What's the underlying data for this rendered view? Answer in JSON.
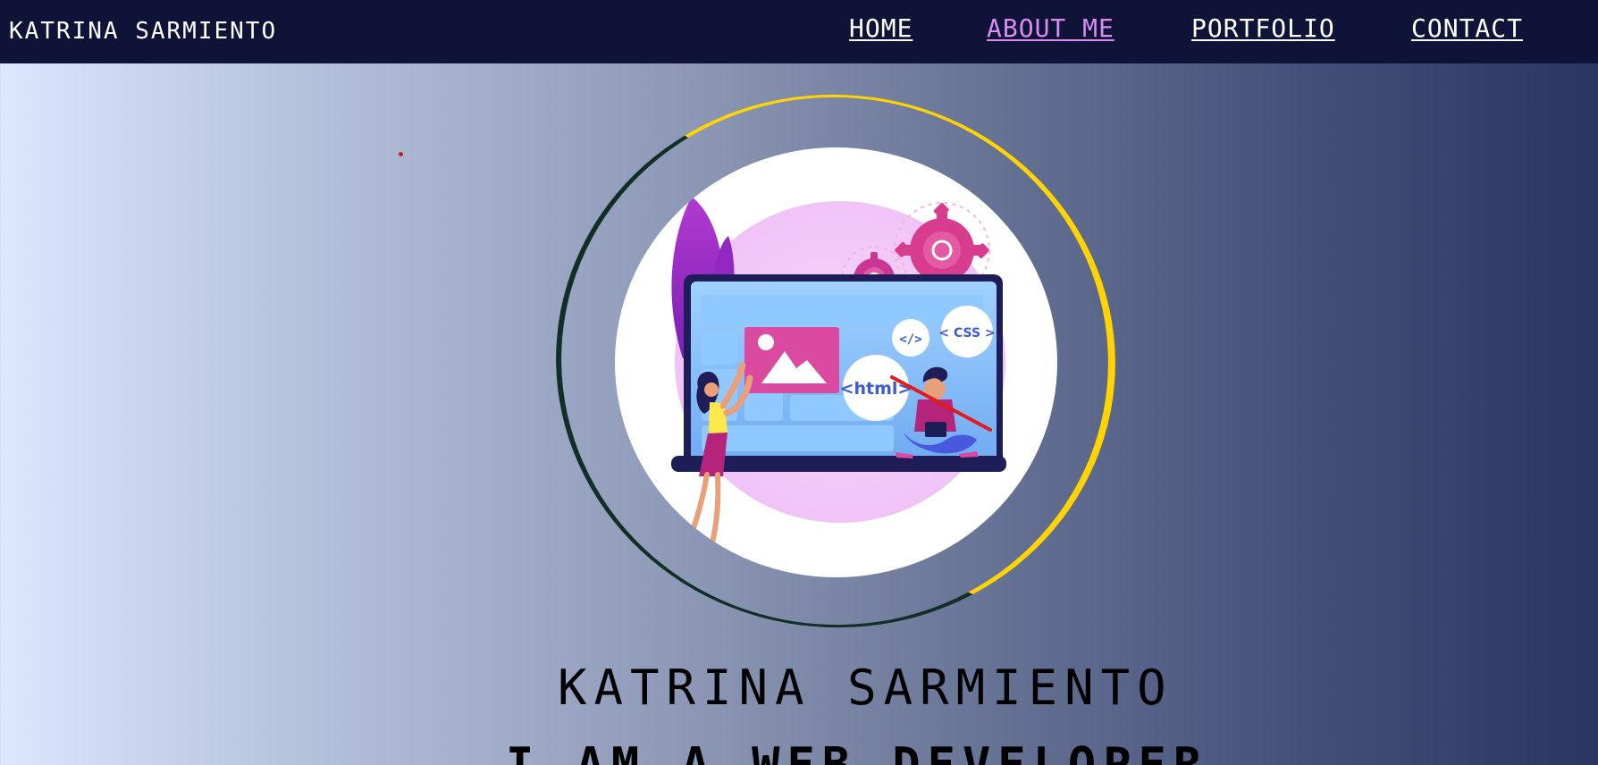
{
  "brand": {
    "name": "KATRINA SARMIENTO"
  },
  "nav": {
    "items": [
      {
        "label": "HOME",
        "active": false
      },
      {
        "label": "ABOUT ME",
        "active": true
      },
      {
        "label": "PORTFOLIO",
        "active": false
      },
      {
        "label": "CONTACT",
        "active": false
      }
    ]
  },
  "hero": {
    "name": "KATRINA SARMIENTO",
    "role": "I AM A WEB DEVELOPER",
    "illustration": {
      "labels": [
        "</>",
        "< CSS >",
        "<html>"
      ]
    }
  },
  "colors": {
    "navbar": "#101338",
    "active_link": "#d98cf2",
    "ring_accent": "#ffd400",
    "ring_dark": "#0f2f27"
  }
}
